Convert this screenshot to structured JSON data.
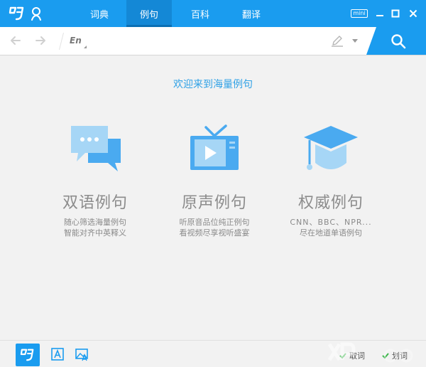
{
  "nav": {
    "tabs": [
      {
        "label": "词典",
        "active": false
      },
      {
        "label": "例句",
        "active": true
      },
      {
        "label": "百科",
        "active": false
      },
      {
        "label": "翻译",
        "active": false
      }
    ]
  },
  "window": {
    "mini_label": "mini"
  },
  "search": {
    "lang_label": "En",
    "value": "",
    "placeholder": ""
  },
  "main": {
    "welcome": "欢迎来到海量例句",
    "features": [
      {
        "title": "双语例句",
        "desc1": "随心筛选海量例句",
        "desc2": "智能对齐中英释义",
        "icon": "bilingual-chat-icon"
      },
      {
        "title": "原声例句",
        "desc1": "听原音品位纯正例句",
        "desc2": "看视频尽享视听盛宴",
        "icon": "tv-play-icon"
      },
      {
        "title": "权威例句",
        "desc1": "CNN、BBC、NPR...",
        "desc2": "尽在地道单语例句",
        "icon": "graduation-cap-icon"
      }
    ]
  },
  "bottom": {
    "toggle1": "取词",
    "toggle2": "划词"
  },
  "colors": {
    "brand_blue": "#1a9cef",
    "active_tab": "#1488d6",
    "icon_light_blue": "#a6d6f6",
    "feature_text": "#8c8c8c"
  }
}
